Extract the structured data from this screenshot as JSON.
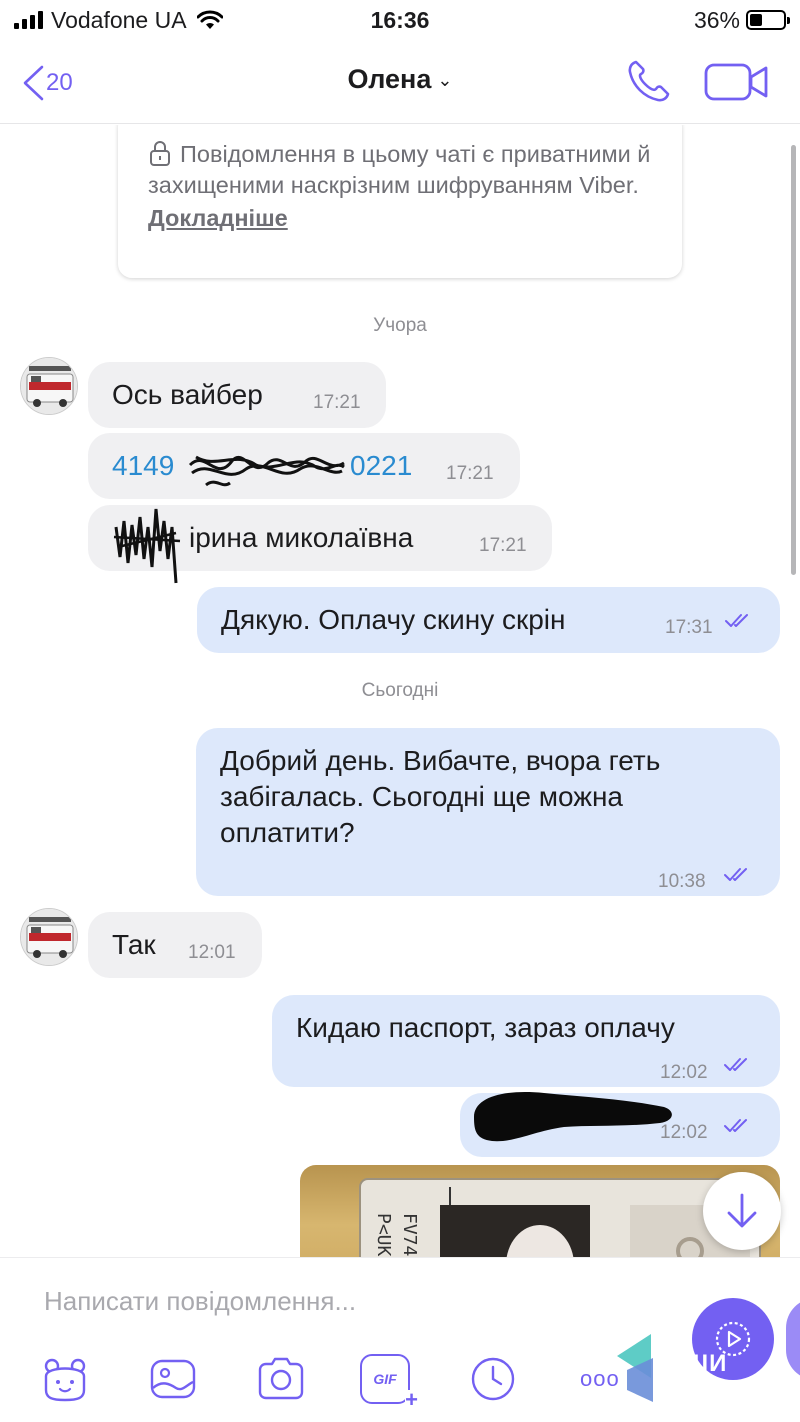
{
  "status_bar": {
    "carrier": "Vodafone UA",
    "time": "16:36",
    "battery": "36%",
    "battery_level": 0.36
  },
  "header": {
    "back_count": "20",
    "contact_name": "Олена",
    "icons": [
      "back-chevron-icon",
      "chevron-down-icon",
      "phone-icon",
      "video-call-icon"
    ]
  },
  "encryption_notice": {
    "text": "Повідомлення в цьому чаті є приватними й захищеними наскрізним шифруванням Viber.",
    "link": "Докладніше"
  },
  "date_separators": {
    "yesterday": "Учора",
    "today": "Сьогодні"
  },
  "messages": [
    {
      "direction": "in",
      "text": "Ось вайбер",
      "time": "17:21"
    },
    {
      "direction": "in",
      "text_visible_start": "4149",
      "text_visible_end": "0221",
      "time": "17:21"
    },
    {
      "direction": "in",
      "text": "ірина миколаївна",
      "time": "17:21"
    },
    {
      "direction": "out",
      "text": "Дякую. Оплачу скину скрін",
      "time": "17:31"
    },
    {
      "direction": "out",
      "text": "Добрий день. Вибачте, вчора геть забігалась. Сьогодні ще можна оплатити?",
      "time": "10:38"
    },
    {
      "direction": "in",
      "text": "Так",
      "time": "12:01"
    },
    {
      "direction": "out",
      "text": "Кидаю паспорт, зараз оплачу",
      "time": "12:02"
    },
    {
      "direction": "out",
      "text": "",
      "time": "12:02"
    }
  ],
  "passport_photo_text": [
    "P<UK",
    "FV74"
  ],
  "composer": {
    "placeholder": "Написати повідомлення...",
    "toolbar_icons": [
      "sticker-icon",
      "gallery-icon",
      "camera-icon",
      "gif-icon",
      "clock-icon",
      "more-icon"
    ],
    "gif_label": "GIF",
    "more_label": "ooo"
  },
  "watermark_text": "РШИ",
  "colors": {
    "accent": "#7360f2",
    "link": "#2a8bd0",
    "outgoing_bubble": "#dde8fb",
    "incoming_bubble": "#f0f0f2"
  }
}
